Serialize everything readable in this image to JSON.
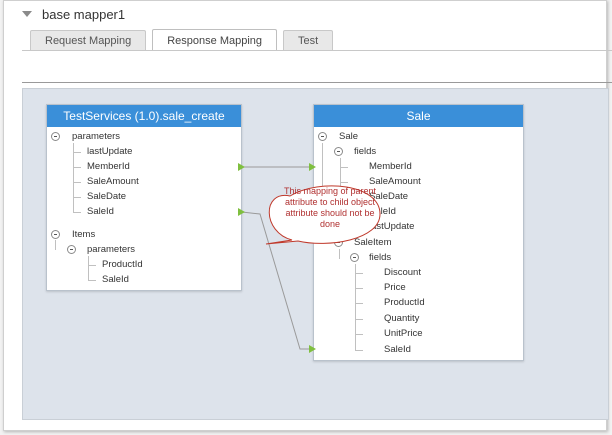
{
  "header": {
    "title": "base mapper1"
  },
  "tabs": [
    {
      "label": "Request Mapping"
    },
    {
      "label": "Response Mapping"
    },
    {
      "label": "Test"
    }
  ],
  "left_panel": {
    "title": "TestServices (1.0).sale_create",
    "nodes": {
      "parameters": "parameters",
      "lastUpdate": "lastUpdate",
      "memberId": "MemberId",
      "saleAmount": "SaleAmount",
      "saleDate": "SaleDate",
      "saleId": "SaleId",
      "items": "Items",
      "items_parameters": "parameters",
      "productId": "ProductId",
      "items_saleId": "SaleId"
    }
  },
  "right_panel": {
    "title": "Sale",
    "nodes": {
      "sale": "Sale",
      "fields": "fields",
      "memberId": "MemberId",
      "saleAmount": "SaleAmount",
      "saleDate": "SaleDate",
      "saleId": "SaleId",
      "lastUpdate": "lastUpdate",
      "saleItem": "SaleItem",
      "item_fields": "fields",
      "discount": "Discount",
      "price": "Price",
      "productId": "ProductId",
      "quantity": "Quantity",
      "unitPrice": "UnitPrice",
      "item_saleId": "SaleId"
    }
  },
  "callout": {
    "text": "This mapping of parent attribute to child object attribute should not be done",
    "text_color": "#b03030",
    "fill_color": "#ffffff"
  },
  "colors": {
    "panel_header": "#3a8fd9",
    "canvas": "#dde3eb",
    "connector": "#7fbf3f"
  }
}
